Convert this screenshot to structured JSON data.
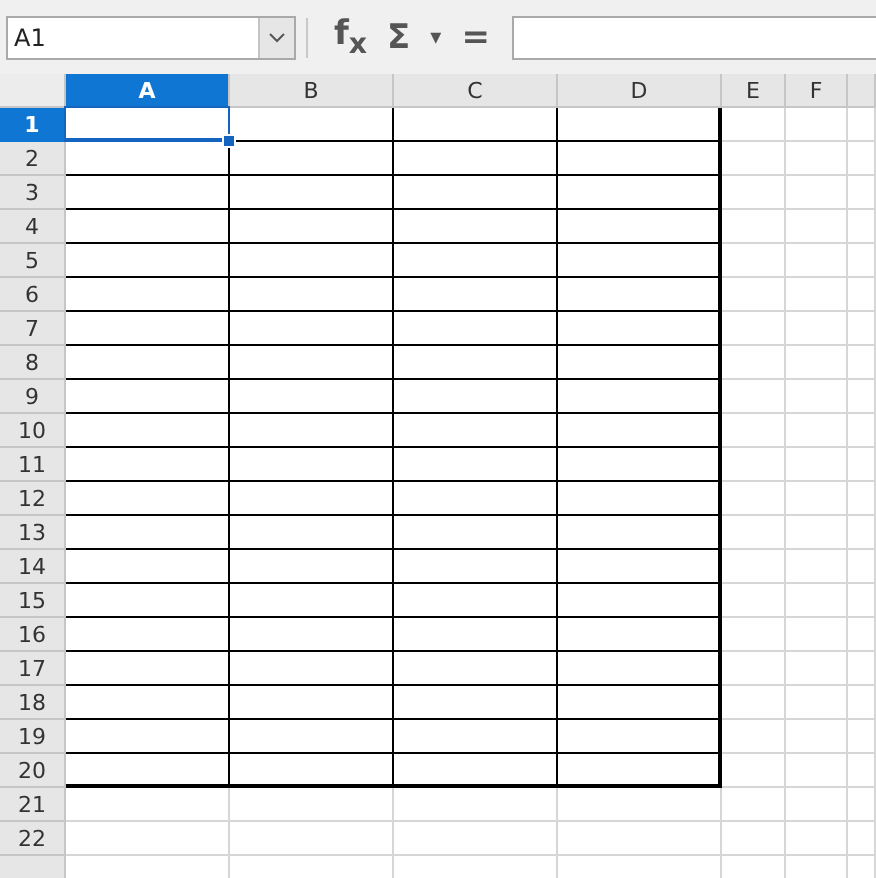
{
  "name_box": {
    "value": "A1"
  },
  "formula_tools": [
    {
      "kind": "function",
      "label": "f$_{x}$"
    },
    {
      "kind": "sum",
      "label": "Σ"
    },
    {
      "kind": "caret",
      "label": "▾"
    },
    {
      "kind": "equals",
      "label": "="
    }
  ],
  "columns": [
    {
      "label": "A",
      "selected": true,
      "bordered": true
    },
    {
      "label": "B",
      "selected": false,
      "bordered": true
    },
    {
      "label": "C",
      "selected": false,
      "bordered": true
    },
    {
      "label": "D",
      "selected": false,
      "bordered": true
    },
    {
      "label": "E",
      "selected": false,
      "bordered": false
    },
    {
      "label": "F",
      "selected": false,
      "bordered": false
    }
  ],
  "rows": [
    {
      "label": "1",
      "selected": true,
      "bordered": true
    },
    {
      "label": "2",
      "selected": false,
      "bordered": true
    },
    {
      "label": "3",
      "selected": false,
      "bordered": true
    },
    {
      "label": "4",
      "selected": false,
      "bordered": true
    },
    {
      "label": "5",
      "selected": false,
      "bordered": true
    },
    {
      "label": "6",
      "selected": false,
      "bordered": true
    },
    {
      "label": "7",
      "selected": false,
      "bordered": true
    },
    {
      "label": "8",
      "selected": false,
      "bordered": true
    },
    {
      "label": "9",
      "selected": false,
      "bordered": true
    },
    {
      "label": "10",
      "selected": false,
      "bordered": true
    },
    {
      "label": "11",
      "selected": false,
      "bordered": true
    },
    {
      "label": "12",
      "selected": false,
      "bordered": true
    },
    {
      "label": "13",
      "selected": false,
      "bordered": true
    },
    {
      "label": "14",
      "selected": false,
      "bordered": true
    },
    {
      "label": "15",
      "selected": false,
      "bordered": true
    },
    {
      "label": "16",
      "selected": false,
      "bordered": true
    },
    {
      "label": "17",
      "selected": false,
      "bordered": true
    },
    {
      "label": "18",
      "selected": false,
      "bordered": true
    },
    {
      "label": "19",
      "selected": false,
      "bordered": true
    },
    {
      "label": "20",
      "selected": false,
      "bordered": true
    },
    {
      "label": "21",
      "selected": false,
      "bordered": false
    },
    {
      "label": "22",
      "selected": false,
      "bordered": false
    }
  ]
}
